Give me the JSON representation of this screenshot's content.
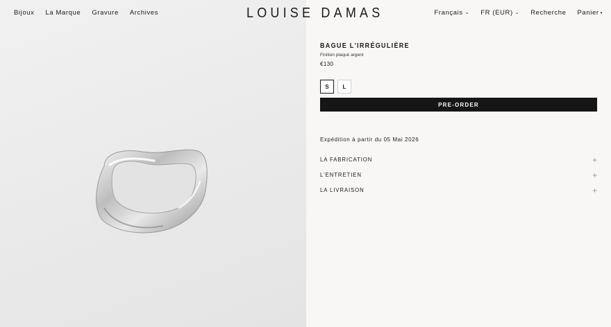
{
  "header": {
    "nav_left": [
      "Bijoux",
      "La Marque",
      "Gravure",
      "Archives"
    ],
    "brand": "LOUISE DAMAS",
    "language": "Français",
    "currency": "FR (EUR)",
    "search": "Recherche",
    "cart": "Panier"
  },
  "product": {
    "title": "BAGUE L'IRRÉGULIÈRE",
    "finish": "Finition plaqué argent",
    "price": "€130",
    "sizes": [
      "S",
      "L"
    ],
    "selected_size": "S",
    "cta": "PRE-ORDER",
    "shipping": "Expédition à partir du 05 Mai 2026"
  },
  "accordions": [
    "LA FABRICATION",
    "L'ENTRETIEN",
    "LA LIVRAISON"
  ],
  "icons": {
    "caret": "chevron-down-icon",
    "cart_dot": "dot-icon",
    "plus": "plus-icon"
  },
  "colors": {
    "cta_bg": "#161616",
    "panel_bg": "#f8f7f5"
  }
}
